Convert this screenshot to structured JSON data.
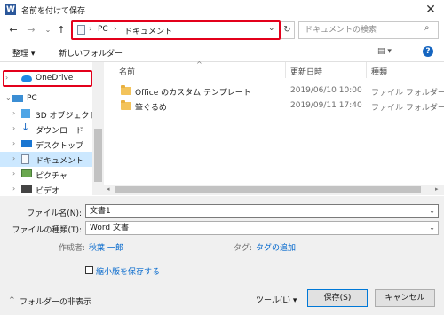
{
  "window": {
    "title": "名前を付けて保存",
    "app_icon_letter": "W",
    "close_glyph": "✕"
  },
  "nav": {
    "back": "←",
    "forward": "→",
    "up": "↑",
    "breadcrumb": [
      "PC",
      "ドキュメント"
    ],
    "separator": "›",
    "refresh": "↻",
    "search_placeholder": "ドキュメントの検索",
    "search_glyph": "⌕"
  },
  "toolbar": {
    "organize": "整理 ▾",
    "new_folder": "新しいフォルダー",
    "view_glyph": "▤ ▾",
    "help": "?"
  },
  "sidebar": {
    "items": [
      {
        "label": "OneDrive",
        "chevron": "›",
        "icon": "cloud-icon"
      },
      {
        "label": "PC",
        "chevron": "⌄",
        "icon": "pc-icon"
      },
      {
        "label": "3D オブジェクト",
        "chevron": "›",
        "icon": "cube-icon"
      },
      {
        "label": "ダウンロード",
        "chevron": "›",
        "icon": "download-icon"
      },
      {
        "label": "デスクトップ",
        "chevron": "›",
        "icon": "desktop-icon"
      },
      {
        "label": "ドキュメント",
        "chevron": "›",
        "icon": "document-icon"
      },
      {
        "label": "ピクチャ",
        "chevron": "›",
        "icon": "pictures-icon"
      },
      {
        "label": "ビデオ",
        "chevron": "›",
        "icon": "video-icon"
      }
    ]
  },
  "filelist": {
    "columns": {
      "name": "名前",
      "date": "更新日時",
      "type": "種類"
    },
    "sort_glyph": "^",
    "rows": [
      {
        "name": "Office のカスタム テンプレート",
        "date": "2019/06/10 10:00",
        "type": "ファイル フォルダー"
      },
      {
        "name": "筆ぐるめ",
        "date": "2019/09/11 17:40",
        "type": "ファイル フォルダー"
      }
    ]
  },
  "form": {
    "filename_label": "ファイル名(N):",
    "filename_value": "文書1",
    "filetype_label": "ファイルの種類(T):",
    "filetype_value": "Word 文書",
    "author_label": "作成者:",
    "author_value": "秋葉 一郎",
    "tags_label": "タグ:",
    "tags_value": "タグの追加",
    "thumbnail_label": "縮小版を保存する",
    "dropdown_glyph": "⌄"
  },
  "footer": {
    "hide_folders": "フォルダーの非表示",
    "tools": "ツール(L)  ▾",
    "save": "保存(S)",
    "cancel": "キャンセル",
    "hide_glyph": "^"
  }
}
